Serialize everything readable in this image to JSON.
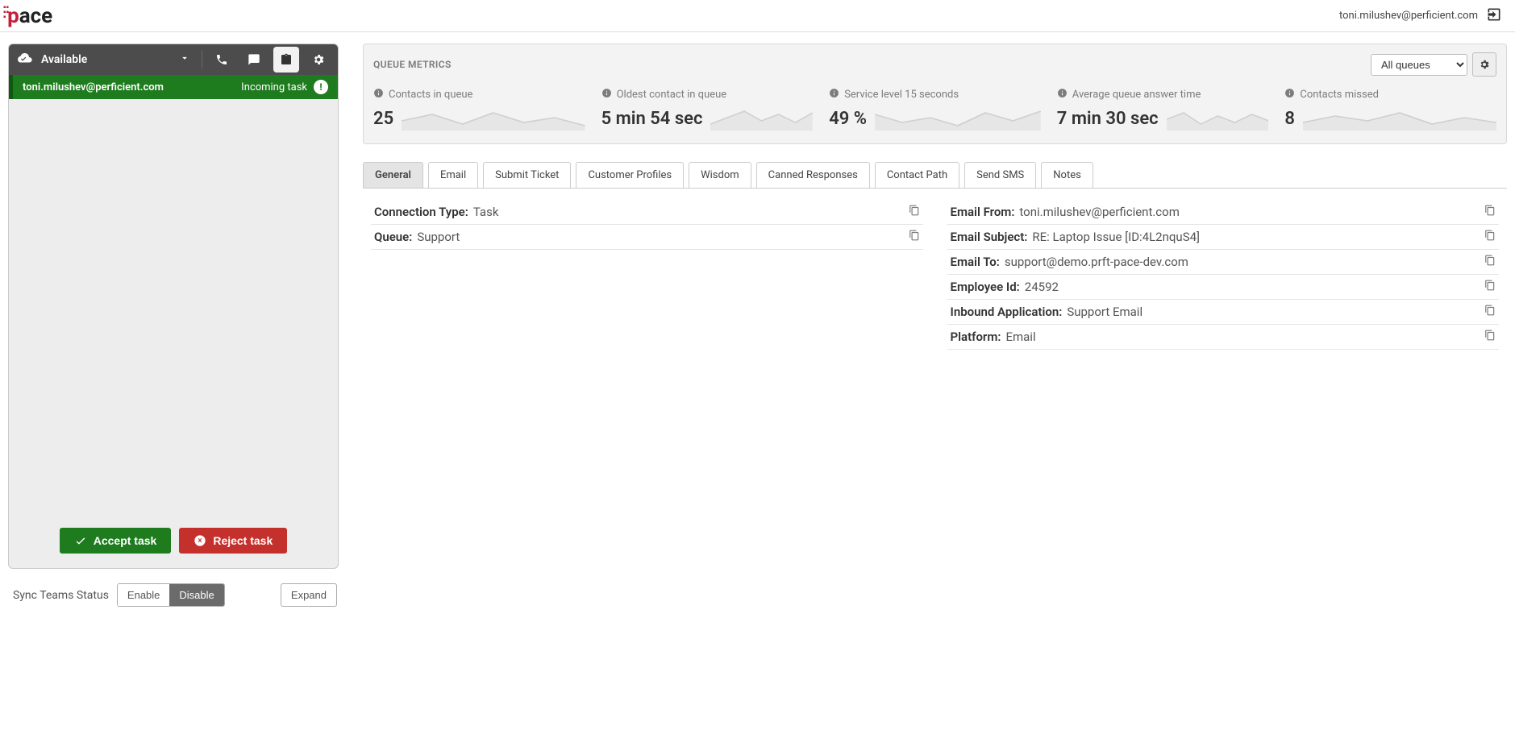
{
  "header": {
    "logo_text_red": "p",
    "logo_text_rest": "ace",
    "user_email": "toni.milushev@perficient.com"
  },
  "ccp": {
    "status_label": "Available",
    "task": {
      "contact": "toni.milushev@perficient.com",
      "status": "Incoming task"
    },
    "accept_label": "Accept task",
    "reject_label": "Reject task"
  },
  "footer": {
    "sync_label": "Sync Teams Status",
    "enable_label": "Enable",
    "disable_label": "Disable",
    "expand_label": "Expand"
  },
  "metrics": {
    "title": "QUEUE METRICS",
    "queue_selector": "All queues",
    "items": [
      {
        "label": "Contacts in queue",
        "value": "25"
      },
      {
        "label": "Oldest contact in queue",
        "value": "5 min 54 sec"
      },
      {
        "label": "Service level 15 seconds",
        "value": "49 %"
      },
      {
        "label": "Average queue answer time",
        "value": "7 min 30 sec"
      },
      {
        "label": "Contacts missed",
        "value": "8"
      }
    ]
  },
  "tabs": [
    "General",
    "Email",
    "Submit Ticket",
    "Customer Profiles",
    "Wisdom",
    "Canned Responses",
    "Contact Path",
    "Send SMS",
    "Notes"
  ],
  "active_tab": "General",
  "general": {
    "left": [
      {
        "key": "Connection Type:",
        "value": "Task"
      },
      {
        "key": "Queue:",
        "value": "Support"
      }
    ],
    "right": [
      {
        "key": "Email From:",
        "value": "toni.milushev@perficient.com"
      },
      {
        "key": "Email Subject:",
        "value": "RE: Laptop Issue [ID:4L2nquS4]"
      },
      {
        "key": "Email To:",
        "value": "support@demo.prft-pace-dev.com"
      },
      {
        "key": "Employee Id:",
        "value": "24592"
      },
      {
        "key": "Inbound Application:",
        "value": "Support Email"
      },
      {
        "key": "Platform:",
        "value": "Email"
      }
    ]
  }
}
